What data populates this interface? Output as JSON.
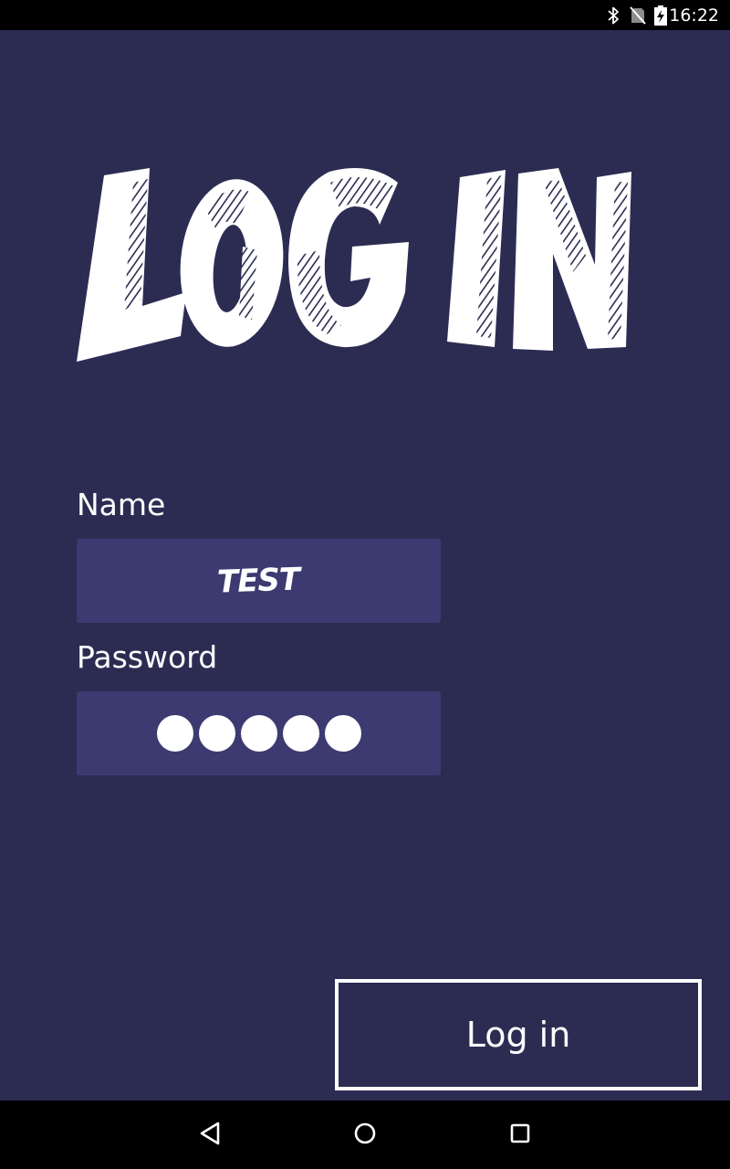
{
  "status_bar": {
    "time": "16:22",
    "icons": [
      "bluetooth-icon",
      "no-sim-icon",
      "battery-charging-icon"
    ]
  },
  "title": {
    "text": "LOG IN",
    "color": "#ffffff",
    "hatch_color": "#2c2c53"
  },
  "form": {
    "name_label": "Name",
    "name_value": "TEST",
    "password_label": "Password",
    "password_length": 5
  },
  "login_button": {
    "label": "Log in"
  },
  "nav_bar": {
    "buttons": [
      "back-icon",
      "home-icon",
      "recents-icon"
    ]
  },
  "colors": {
    "background": "#2c2c53",
    "field_background": "#3c3a70",
    "text": "#ffffff",
    "system_bars": "#000000"
  }
}
